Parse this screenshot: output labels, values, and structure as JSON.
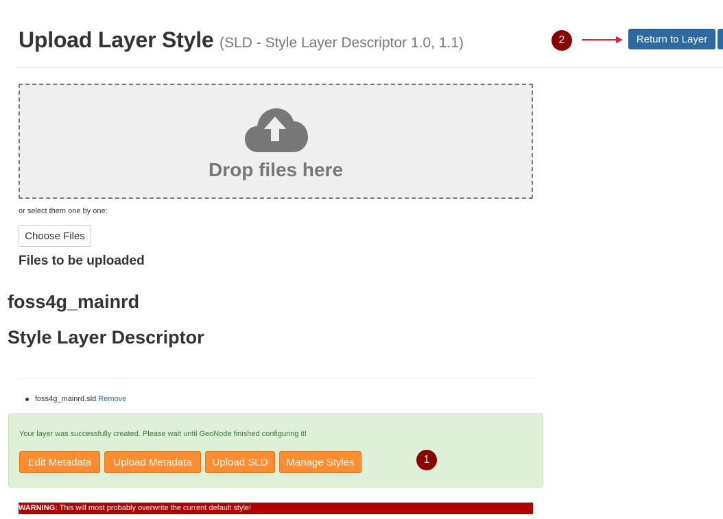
{
  "header": {
    "title": "Upload Layer Style",
    "subtitle": "(SLD - Style Layer Descriptor 1.0, 1.1)",
    "return_button_label": "Return to Layer"
  },
  "markers": {
    "marker_1": "1",
    "marker_2": "2"
  },
  "dropzone": {
    "icon": "cloud-upload-icon",
    "text": "Drop files here"
  },
  "file_select": {
    "hint": "or select them one by one:",
    "choose_button_label": "Choose Files"
  },
  "files_heading": "Files to be uploaded",
  "layer": {
    "name": "foss4g_mainrd",
    "heading": "Style Layer Descriptor"
  },
  "file_list": [
    {
      "filename": "foss4g_mainrd.sld",
      "remove_label": "Remove"
    }
  ],
  "alert": {
    "message": "Your layer was successfully created. Please wait until GeoNode finished configuring it!",
    "buttons": [
      "Edit Metadata",
      "Upload Metadata",
      "Upload SLD",
      "Manage Styles"
    ]
  },
  "warning": {
    "label": "WARNING:",
    "text": " This will most probably overwrite the current default style!"
  },
  "colors": {
    "primary_blue": "#2c6aa0",
    "orange": "#ff8c2e",
    "success_bg": "#dff0d8",
    "warning_red": "#b30000",
    "marker_red": "#8b0000"
  }
}
